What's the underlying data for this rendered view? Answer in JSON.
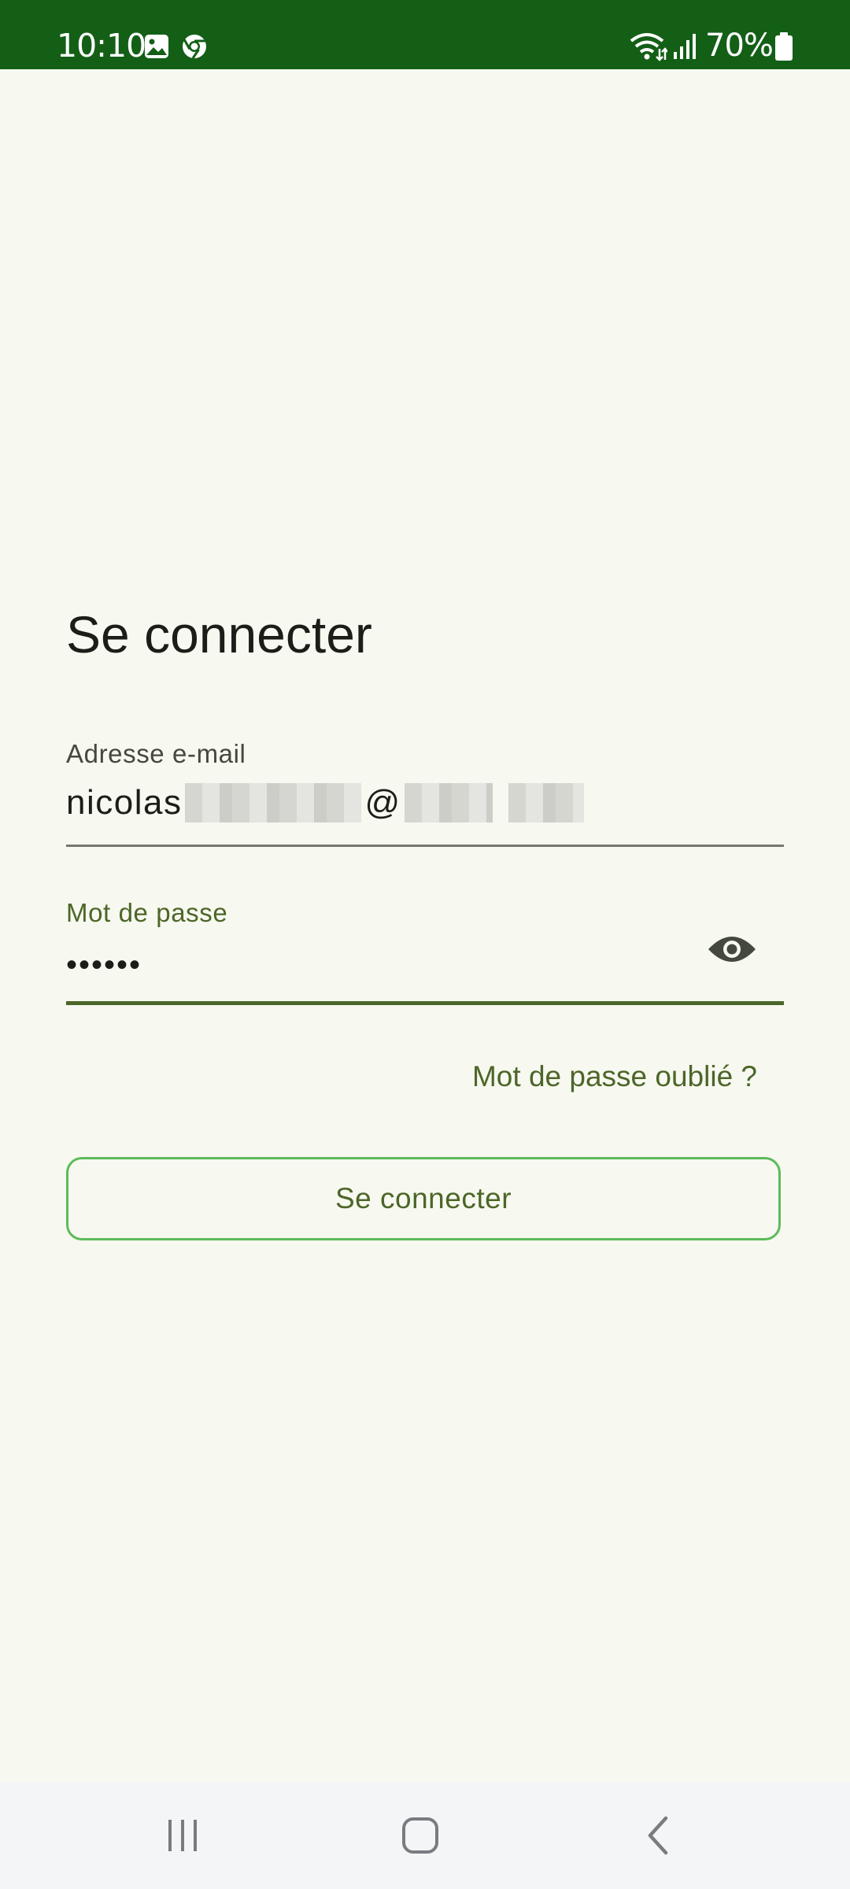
{
  "status_bar": {
    "time": "10:10",
    "battery": "70%",
    "icons": [
      "gallery-icon",
      "chrome-icon",
      "wifi-icon",
      "signal-icon",
      "battery-icon"
    ],
    "background_color": "#135f16"
  },
  "login": {
    "title": "Se connecter",
    "email": {
      "label": "Adresse e-mail",
      "value_prefix": "nicolas",
      "value_at": "@",
      "value_redacted": true
    },
    "password": {
      "label": "Mot de passe",
      "value": "••••••",
      "toggle_icon": "eye-icon"
    },
    "forgot_password": "Mot de passe oublié ?",
    "submit_label": "Se connecter",
    "accent_color": "#4c6628",
    "button_border_color": "#5dbb5a"
  },
  "nav_bar": {
    "buttons": [
      "recent-apps-icon",
      "home-icon",
      "back-icon"
    ]
  }
}
